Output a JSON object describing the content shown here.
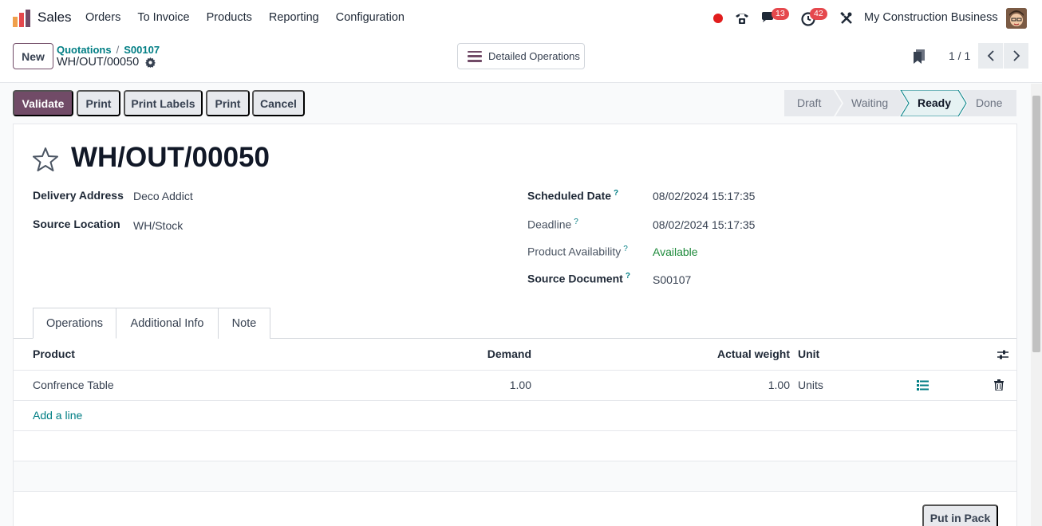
{
  "navbar": {
    "app_name": "Sales",
    "menu": [
      "Orders",
      "To Invoice",
      "Products",
      "Reporting",
      "Configuration"
    ],
    "messages_badge": "13",
    "activities_badge": "42",
    "company": "My Construction Business"
  },
  "control": {
    "new_label": "New",
    "breadcrumb": [
      "Quotations",
      "S00107"
    ],
    "record_name": "WH/OUT/00050",
    "detailed_operations": "Detailed Operations",
    "pager": "1 / 1"
  },
  "actions": {
    "validate": "Validate",
    "print": "Print",
    "print_labels": "Print Labels",
    "print2": "Print",
    "cancel": "Cancel"
  },
  "status": {
    "stages": [
      "Draft",
      "Waiting",
      "Ready",
      "Done"
    ],
    "active": "Ready"
  },
  "form": {
    "title": "WH/OUT/00050",
    "delivery_address_label": "Delivery Address",
    "delivery_address": "Deco Addict",
    "source_location_label": "Source Location",
    "source_location": "WH/Stock",
    "scheduled_date_label": "Scheduled Date",
    "scheduled_date": "08/02/2024 15:17:35",
    "deadline_label": "Deadline",
    "deadline": "08/02/2024 15:17:35",
    "availability_label": "Product Availability",
    "availability": "Available",
    "source_document_label": "Source Document",
    "source_document": "S00107",
    "help_mark": "?"
  },
  "tabs": [
    "Operations",
    "Additional Info",
    "Note"
  ],
  "table": {
    "headers": {
      "product": "Product",
      "demand": "Demand",
      "actual_weight": "Actual weight",
      "unit": "Unit"
    },
    "rows": [
      {
        "product": "Confrence Table",
        "demand": "1.00",
        "actual_weight": "1.00",
        "unit": "Units"
      }
    ],
    "add_line": "Add a line"
  },
  "put_in_pack": "Put in Pack",
  "colors": {
    "brand": "#714b67",
    "link": "#017e84",
    "available": "#1e8a3b",
    "badge": "#e5484d"
  }
}
